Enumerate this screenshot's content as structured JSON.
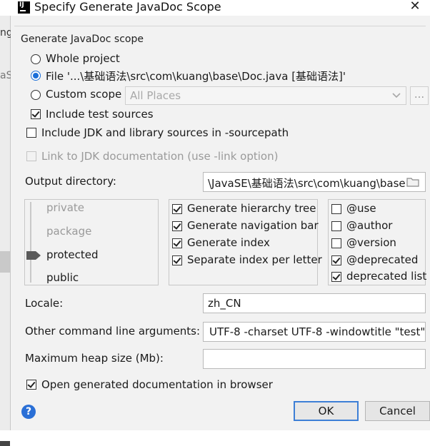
{
  "window": {
    "title": "Specify Generate JavaDoc Scope",
    "close_glyph": "✕"
  },
  "background": {
    "left_text_1": "ng",
    "left_text_2": "aS"
  },
  "scope": {
    "group_label": "Generate JavaDoc scope",
    "whole_project": "Whole project",
    "file": "File '...\\基础语法\\src\\com\\kuang\\base\\Doc.java [基础语法]'",
    "custom_scope": "Custom scope",
    "custom_scope_value": "All Places",
    "dots": "...",
    "include_test_sources": "Include test sources"
  },
  "options": {
    "include_jdk": "Include JDK and library sources in -sourcepath",
    "link_jdk": "Link to JDK documentation (use -link option)"
  },
  "output": {
    "label": "Output directory:",
    "value": "\\JavaSE\\基础语法\\src\\com\\kuang\\base"
  },
  "visibility": {
    "levels": [
      "private",
      "package",
      "protected",
      "public"
    ],
    "selected": "protected"
  },
  "generate": {
    "hierarchy": "Generate hierarchy tree",
    "navigation": "Generate navigation bar",
    "index": "Generate index",
    "separate_index": "Separate index per letter"
  },
  "tags": {
    "use": "@use",
    "author": "@author",
    "version": "@version",
    "deprecated": "@deprecated",
    "deprecated_list": "deprecated list"
  },
  "locale": {
    "label": "Locale:",
    "value": "zh_CN"
  },
  "args": {
    "label": "Other command line arguments:",
    "value": "UTF-8 -charset UTF-8 -windowtitle \"test\""
  },
  "heap": {
    "label": "Maximum heap size (Mb):",
    "value": ""
  },
  "open_browser": "Open generated documentation in browser",
  "buttons": {
    "ok": "OK",
    "cancel": "Cancel",
    "help": "?"
  },
  "colors": {
    "accent": "#3d7fd6",
    "radio_selected": "#1a6ed8",
    "dialog_bg": "#f2f2f2"
  }
}
